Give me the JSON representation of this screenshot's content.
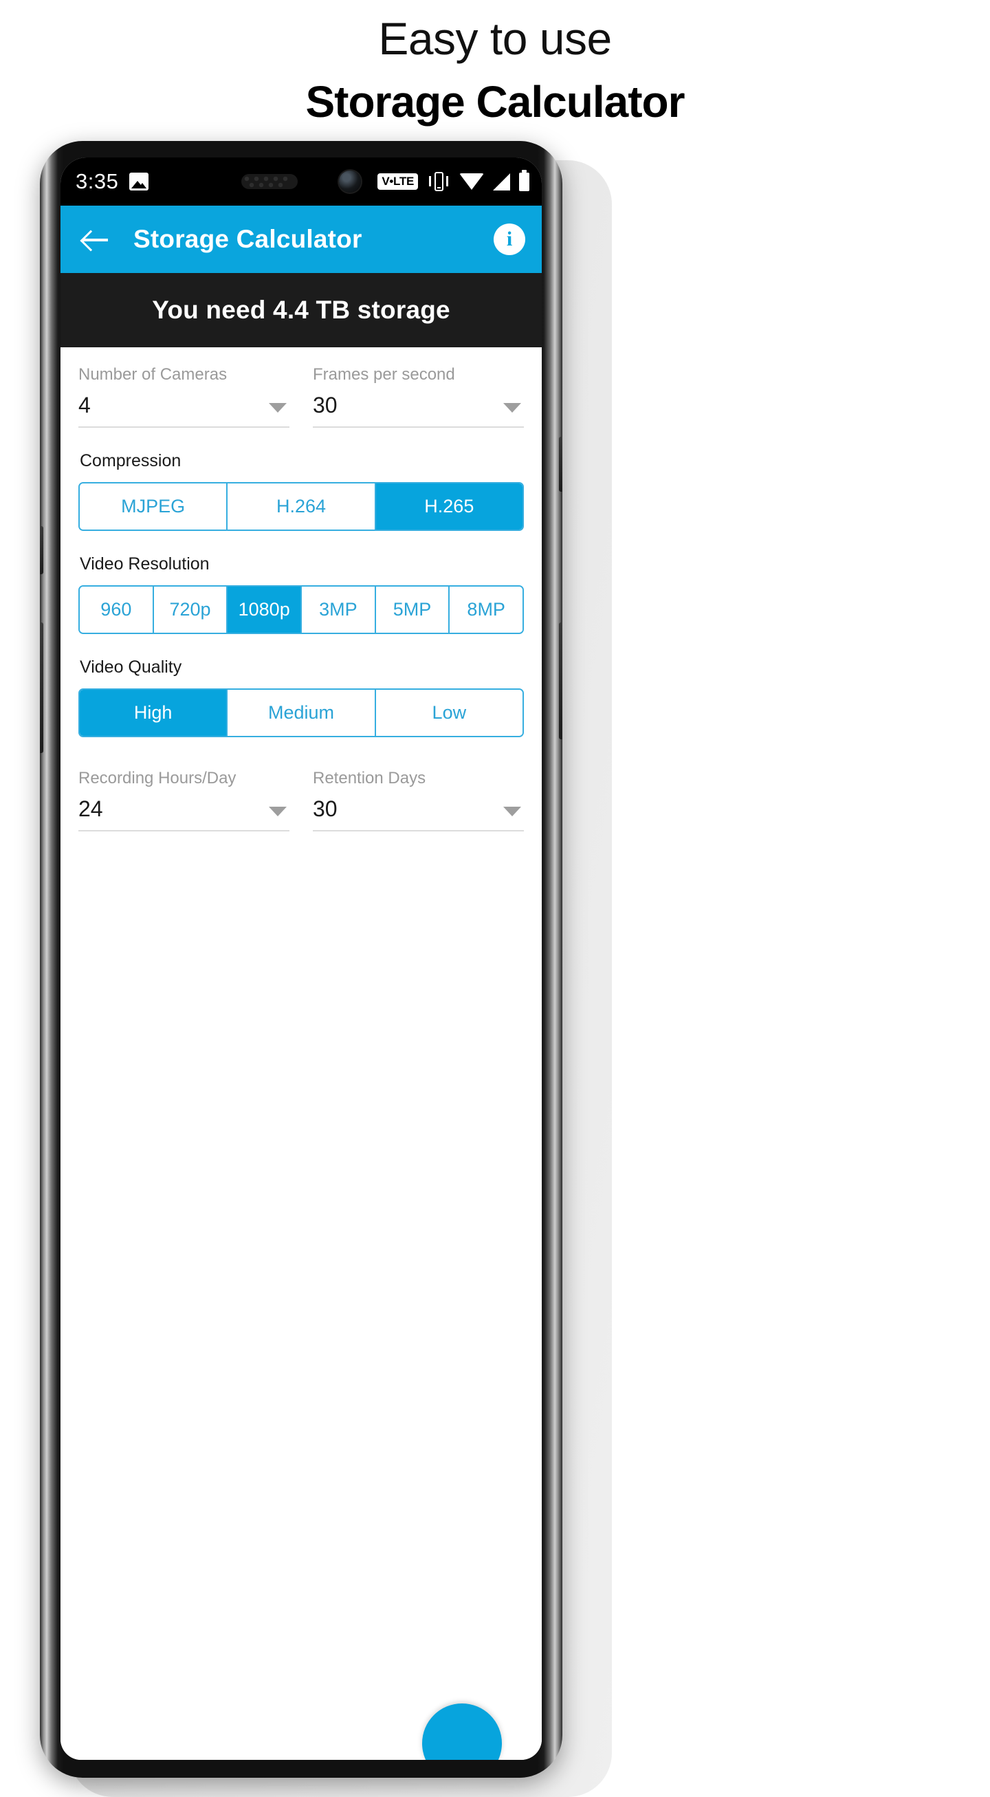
{
  "promo": {
    "line1": "Easy to use",
    "line2": "Storage Calculator"
  },
  "statusbar": {
    "time": "3:35",
    "photo_icon": "image-icon",
    "volte_label": "V•LTE",
    "vibrate_icon": "vibrate-icon",
    "wifi_icon": "wifi-icon",
    "signal_icon": "cellular-signal-icon",
    "battery_icon": "battery-full-icon"
  },
  "appbar": {
    "back_icon": "back-arrow-icon",
    "title": "Storage Calculator",
    "info_label": "i",
    "accent_color": "#0aa5dd"
  },
  "result": {
    "text": "You need 4.4 TB storage",
    "background_color": "#1c1c1c"
  },
  "form": {
    "cameras": {
      "label": "Number of Cameras",
      "value": "4"
    },
    "fps": {
      "label": "Frames per second",
      "value": "30"
    },
    "compression": {
      "label": "Compression",
      "options": [
        "MJPEG",
        "H.264",
        "H.265"
      ],
      "selected": "H.265"
    },
    "resolution": {
      "label": "Video Resolution",
      "options": [
        "960",
        "720p",
        "1080p",
        "3MP",
        "5MP",
        "8MP"
      ],
      "selected": "1080p"
    },
    "quality": {
      "label": "Video Quality",
      "options": [
        "High",
        "Medium",
        "Low"
      ],
      "selected": "High"
    },
    "recording_hours": {
      "label": "Recording Hours/Day",
      "value": "24"
    },
    "retention_days": {
      "label": "Retention Days",
      "value": "30"
    }
  },
  "fab": {
    "name": "floating-action-button",
    "color": "#07a4dd"
  }
}
